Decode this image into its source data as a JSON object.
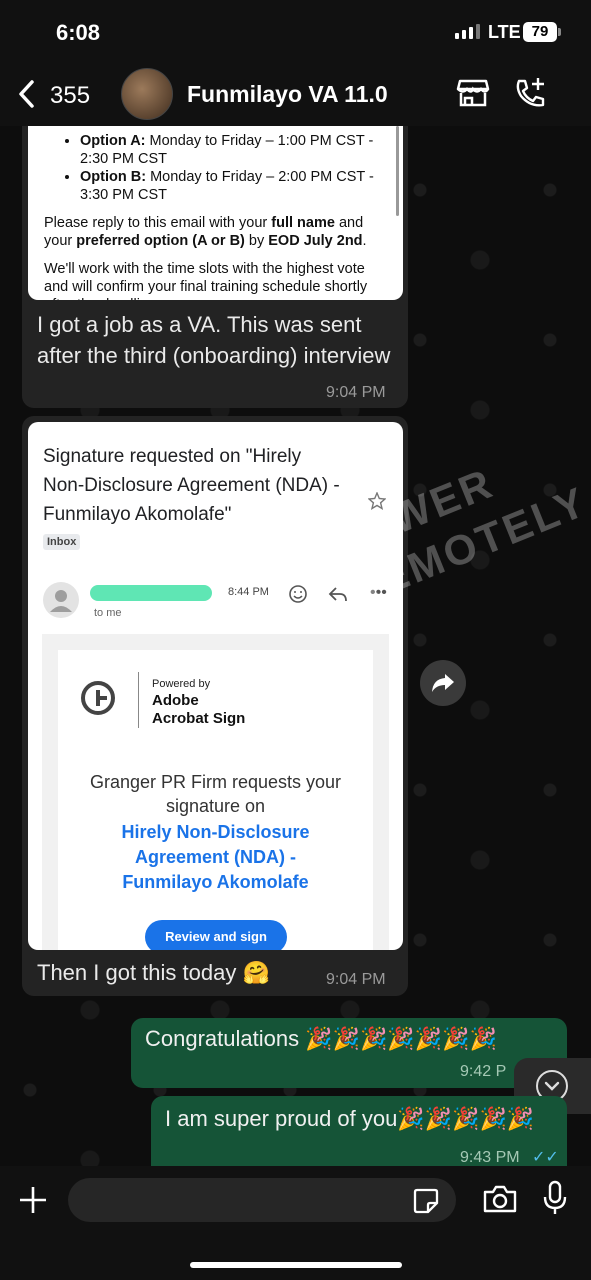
{
  "status_bar": {
    "time": "6:08",
    "network": "LTE",
    "battery": "79"
  },
  "header": {
    "back_count": "355",
    "contact_name": "Funmilayo VA 11.0"
  },
  "messages": {
    "first": {
      "email": {
        "option_a_label": "Option A:",
        "option_a_text": " Monday to Friday – 1:00 PM CST - 2:30 PM CST",
        "option_b_label": "Option B:",
        "option_b_text": " Monday to Friday – 2:00 PM CST - 3:30 PM CST",
        "reply_1": "Please reply to this email with your ",
        "reply_bold_1": "full name",
        "reply_2": " and your ",
        "reply_bold_2": "preferred option (A or B)",
        "reply_3": " by ",
        "reply_bold_3": "EOD July 2nd",
        "reply_4": ".",
        "closing": "We'll work with the time slots with the highest vote and will confirm your final training schedule shortly after the deadline."
      },
      "caption": "I got a job as a VA. This was sent after the third (onboarding) interview",
      "time": "9:04 PM"
    },
    "second": {
      "email": {
        "subject": "Signature requested on \"Hirely Non-Disclosure Agreement (NDA) - Funmilayo Akomolafe\"",
        "label": "Inbox",
        "sent_time": "8:44 PM",
        "to": "to me",
        "powered_by": "Powered by",
        "adobe": "Adobe",
        "acrobat": "Acrobat Sign",
        "request_line_1": "Granger PR Firm requests your",
        "request_line_2": "signature on",
        "doc_title": "Hirely Non-Disclosure Agreement (NDA) - Funmilayo Akomolafe",
        "review_button": "Review and sign"
      },
      "caption": "Then I got this today 🤗",
      "time": "9:04 PM"
    },
    "third": {
      "text": "Congratulations 🎉🎉🎉🎉🎉🎉🎉",
      "time": "9:42 P"
    },
    "fourth": {
      "text": "I am super proud of you🎉🎉🎉🎉🎉",
      "time": "9:43 PM",
      "read_receipt": "✓✓"
    }
  },
  "watermark": "POWER REMOTELY",
  "colors": {
    "accent_blue": "#1a73e8",
    "outgoing_bubble": "#155437",
    "incoming_bubble": "#232323",
    "read_receipt": "#53bdeb"
  },
  "icons": [
    "chevron-left-icon",
    "store-icon",
    "call-add-icon",
    "forward-icon",
    "chevron-down-icon",
    "plus-icon",
    "sticker-icon",
    "camera-icon",
    "mic-icon",
    "star-icon",
    "emoji-icon",
    "reply-icon",
    "more-icon"
  ]
}
